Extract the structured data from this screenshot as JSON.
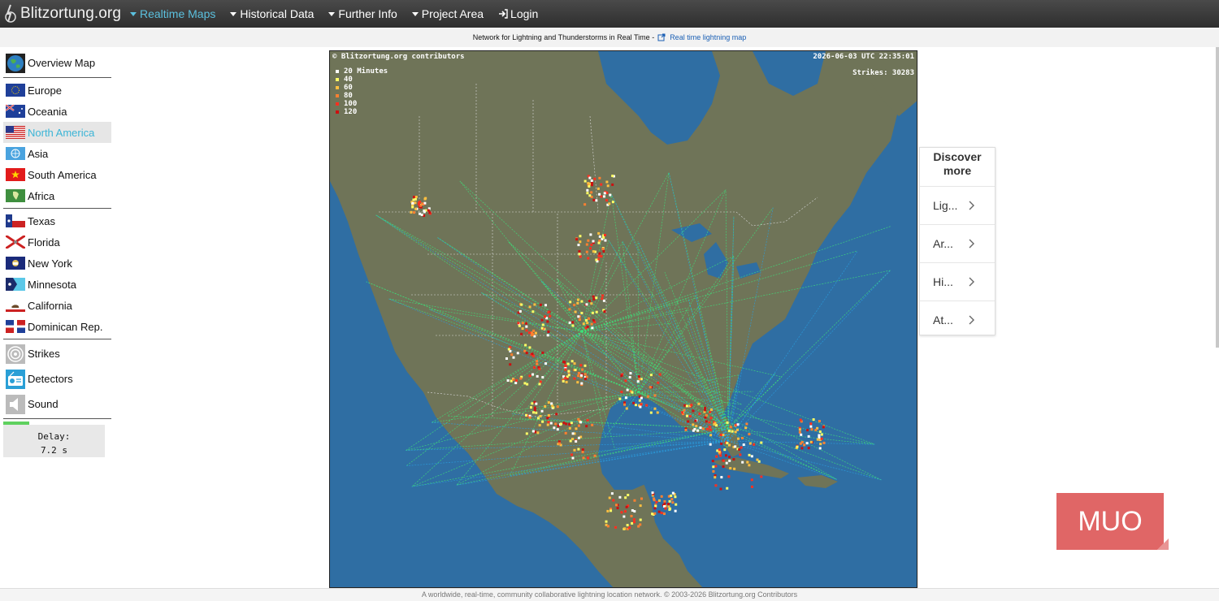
{
  "header": {
    "brand": "Blitzortung.org",
    "nav": [
      {
        "label": "Realtime Maps",
        "active": true
      },
      {
        "label": "Historical Data",
        "active": false
      },
      {
        "label": "Further Info",
        "active": false
      },
      {
        "label": "Project Area",
        "active": false
      }
    ],
    "login": "Login"
  },
  "subheader": {
    "text": "Network for Lightning and Thunderstorms in Real Time -",
    "link": "Real time lightning map"
  },
  "sidebar": {
    "overview": "Overview Map",
    "regions": [
      "Europe",
      "Oceania",
      "North America",
      "Asia",
      "South America",
      "Africa"
    ],
    "active_region": "North America",
    "states": [
      "Texas",
      "Florida",
      "New York",
      "Minnesota",
      "California",
      "Dominican Rep."
    ],
    "tools": [
      "Strikes",
      "Detectors",
      "Sound"
    ],
    "delay_label": "Delay:",
    "delay_value": "7.2 s"
  },
  "map": {
    "credit": "© Blitzortung.org contributors",
    "timestamp": "2026-06-03 UTC 22:35:01",
    "strikes": "Strikes: 30283",
    "legend": [
      {
        "label": "20 Minutes",
        "color": "#ffffff"
      },
      {
        "label": "40",
        "color": "#ffff66"
      },
      {
        "label": "60",
        "color": "#ffc040"
      },
      {
        "label": "80",
        "color": "#ff8030"
      },
      {
        "label": "100",
        "color": "#ff3020"
      },
      {
        "label": "120",
        "color": "#cc1010"
      }
    ]
  },
  "discover": {
    "title": "Discover more",
    "items": [
      "Lig...",
      "Ar...",
      "Hi...",
      "At..."
    ]
  },
  "footer": "A worldwide, real-time, community collaborative lightning location network. © 2003-2026 Blitzortung.org Contributors",
  "watermark": "MUO",
  "colors": {
    "accent": "#5bc0de",
    "land": "#6f7458",
    "water": "#2f6ea3",
    "muo": "#e06666"
  }
}
